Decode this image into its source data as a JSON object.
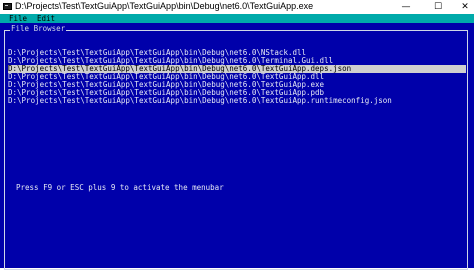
{
  "window": {
    "title": "D:\\Projects\\Test\\TextGuiApp\\TextGuiApp\\bin\\Debug\\net6.0\\TextGuiApp.exe",
    "minimize_glyph": "—",
    "maximize_glyph": "☐",
    "close_glyph": "✕"
  },
  "menubar": {
    "items": [
      {
        "label": "File"
      },
      {
        "label": "Edit"
      }
    ]
  },
  "file_browser": {
    "title": "File Browser",
    "files": [
      {
        "path": "D:\\Projects\\Test\\TextGuiApp\\TextGuiApp\\bin\\Debug\\net6.0\\NStack.dll",
        "selected": false
      },
      {
        "path": "D:\\Projects\\Test\\TextGuiApp\\TextGuiApp\\bin\\Debug\\net6.0\\Terminal.Gui.dll",
        "selected": false
      },
      {
        "path": "D:\\Projects\\Test\\TextGuiApp\\TextGuiApp\\bin\\Debug\\net6.0\\TextGuiApp.deps.json",
        "selected": true
      },
      {
        "path": "D:\\Projects\\Test\\TextGuiApp\\TextGuiApp\\bin\\Debug\\net6.0\\TextGuiApp.dll",
        "selected": false
      },
      {
        "path": "D:\\Projects\\Test\\TextGuiApp\\TextGuiApp\\bin\\Debug\\net6.0\\TextGuiApp.exe",
        "selected": false
      },
      {
        "path": "D:\\Projects\\Test\\TextGuiApp\\TextGuiApp\\bin\\Debug\\net6.0\\TextGuiApp.pdb",
        "selected": false
      },
      {
        "path": "D:\\Projects\\Test\\TextGuiApp\\TextGuiApp\\bin\\Debug\\net6.0\\TextGuiApp.runtimeconfig.json",
        "selected": false
      }
    ]
  },
  "status": {
    "hint": "Press F9 or ESC plus 9 to activate the menubar"
  },
  "colors": {
    "console_background": "#0000aa",
    "menubar_background": "#00aaaa",
    "selection_background": "#cfcfcf",
    "text": "#e6e9f5"
  }
}
